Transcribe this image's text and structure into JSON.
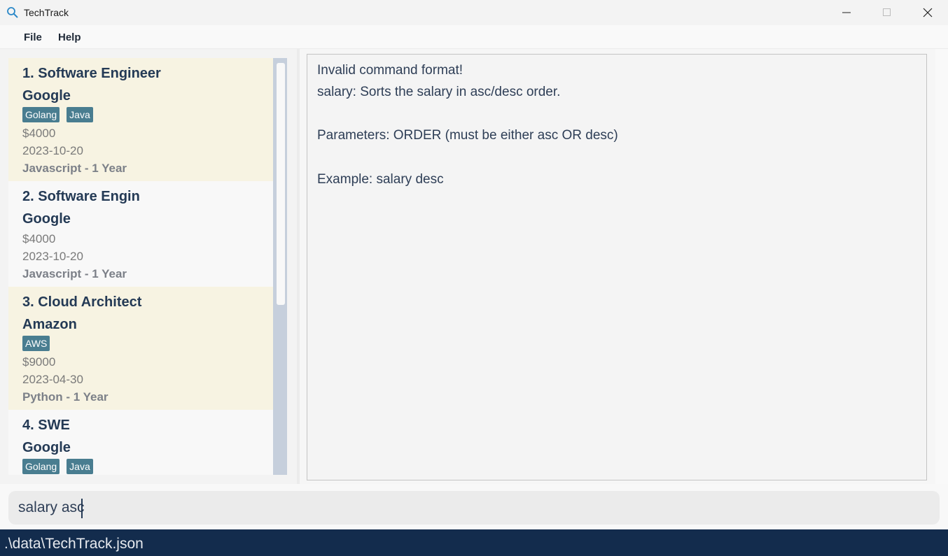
{
  "window": {
    "title": "TechTrack",
    "icon": "magnifier-icon"
  },
  "menu": {
    "file": "File",
    "help": "Help"
  },
  "jobs": [
    {
      "index_title": "1.  Software Engineer",
      "company": "Google",
      "tags": [
        "Golang",
        "Java"
      ],
      "salary": "$4000",
      "deadline": "2023-10-20",
      "experience": "Javascript - 1 Year"
    },
    {
      "index_title": "2.  Software Engin",
      "company": "Google",
      "tags": [],
      "salary": "$4000",
      "deadline": "2023-10-20",
      "experience": "Javascript - 1 Year"
    },
    {
      "index_title": "3.  Cloud Architect",
      "company": "Amazon",
      "tags": [
        "AWS"
      ],
      "salary": "$9000",
      "deadline": "2023-04-30",
      "experience": "Python - 1 Year"
    },
    {
      "index_title": "4.  SWE",
      "company": "Google",
      "tags": [
        "Golang",
        "Java"
      ]
    }
  ],
  "result": {
    "lines": [
      "Invalid command format!",
      "salary: Sorts the salary in asc/desc order.",
      "",
      "Parameters: ORDER (must be either asc OR desc)",
      "",
      "Example: salary desc"
    ]
  },
  "command": {
    "value": "salary asc"
  },
  "status": {
    "path": ".\\data\\TechTrack.json"
  },
  "colors": {
    "tag_bg": "#497d90",
    "status_bg": "#132c4d",
    "highlight_card": "#f7f3e2",
    "text_primary": "#243a55"
  }
}
